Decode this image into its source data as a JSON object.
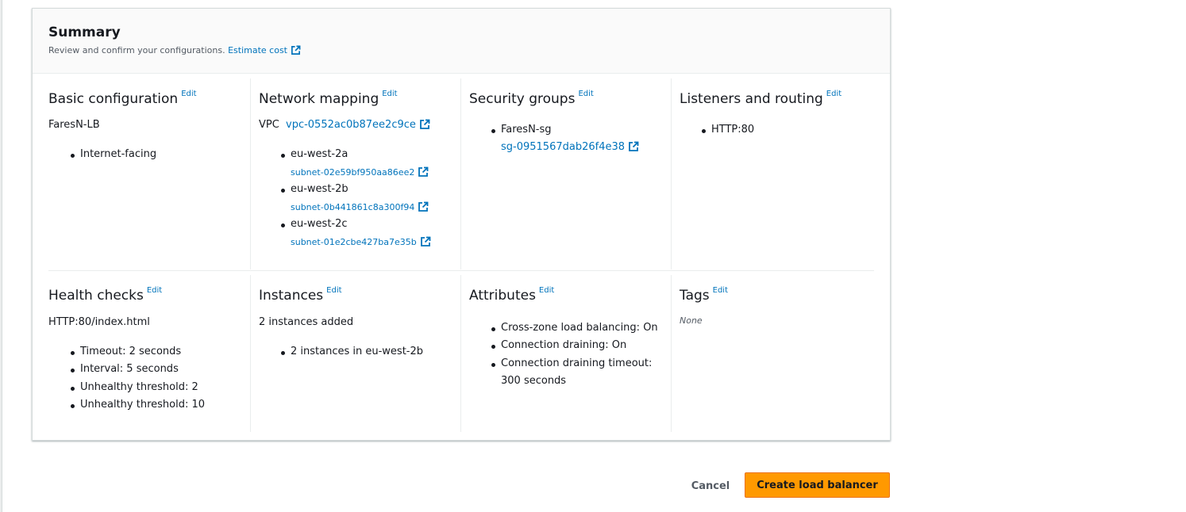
{
  "summary": {
    "title": "Summary",
    "description": "Review and confirm your configurations.",
    "estimate_cost_link": "Estimate cost"
  },
  "edit_label": "Edit",
  "basic_configuration": {
    "title": "Basic configuration",
    "name": "FaresN-LB",
    "scheme": "Internet-facing"
  },
  "network_mapping": {
    "title": "Network mapping",
    "vpc_label": "VPC",
    "vpc_id": "vpc-0552ac0b87ee2c9ce",
    "zones": [
      {
        "zone": "eu-west-2a",
        "subnet": "subnet-02e59bf950aa86ee2"
      },
      {
        "zone": "eu-west-2b",
        "subnet": "subnet-0b441861c8a300f94"
      },
      {
        "zone": "eu-west-2c",
        "subnet": "subnet-01e2cbe427ba7e35b"
      }
    ]
  },
  "security_groups": {
    "title": "Security groups",
    "group_name": "FaresN-sg",
    "group_id": "sg-0951567dab26f4e38"
  },
  "listeners": {
    "title": "Listeners and routing",
    "items": [
      "HTTP:80"
    ]
  },
  "health_checks": {
    "title": "Health checks",
    "target": "HTTP:80/index.html",
    "items": [
      "Timeout: 2 seconds",
      "Interval: 5 seconds",
      "Unhealthy threshold: 2",
      "Unhealthy threshold: 10"
    ]
  },
  "instances": {
    "title": "Instances",
    "summary": "2 instances added",
    "items": [
      "2 instances in eu-west-2b"
    ]
  },
  "attributes": {
    "title": "Attributes",
    "items": [
      "Cross-zone load balancing: On",
      "Connection draining: On",
      "Connection draining timeout:",
      "300 seconds"
    ]
  },
  "tags": {
    "title": "Tags",
    "value": "None"
  },
  "actions": {
    "cancel": "Cancel",
    "create": "Create load balancer"
  },
  "colors": {
    "link": "#0073bb",
    "primary_button": "#ff9900",
    "text": "#16191f"
  }
}
